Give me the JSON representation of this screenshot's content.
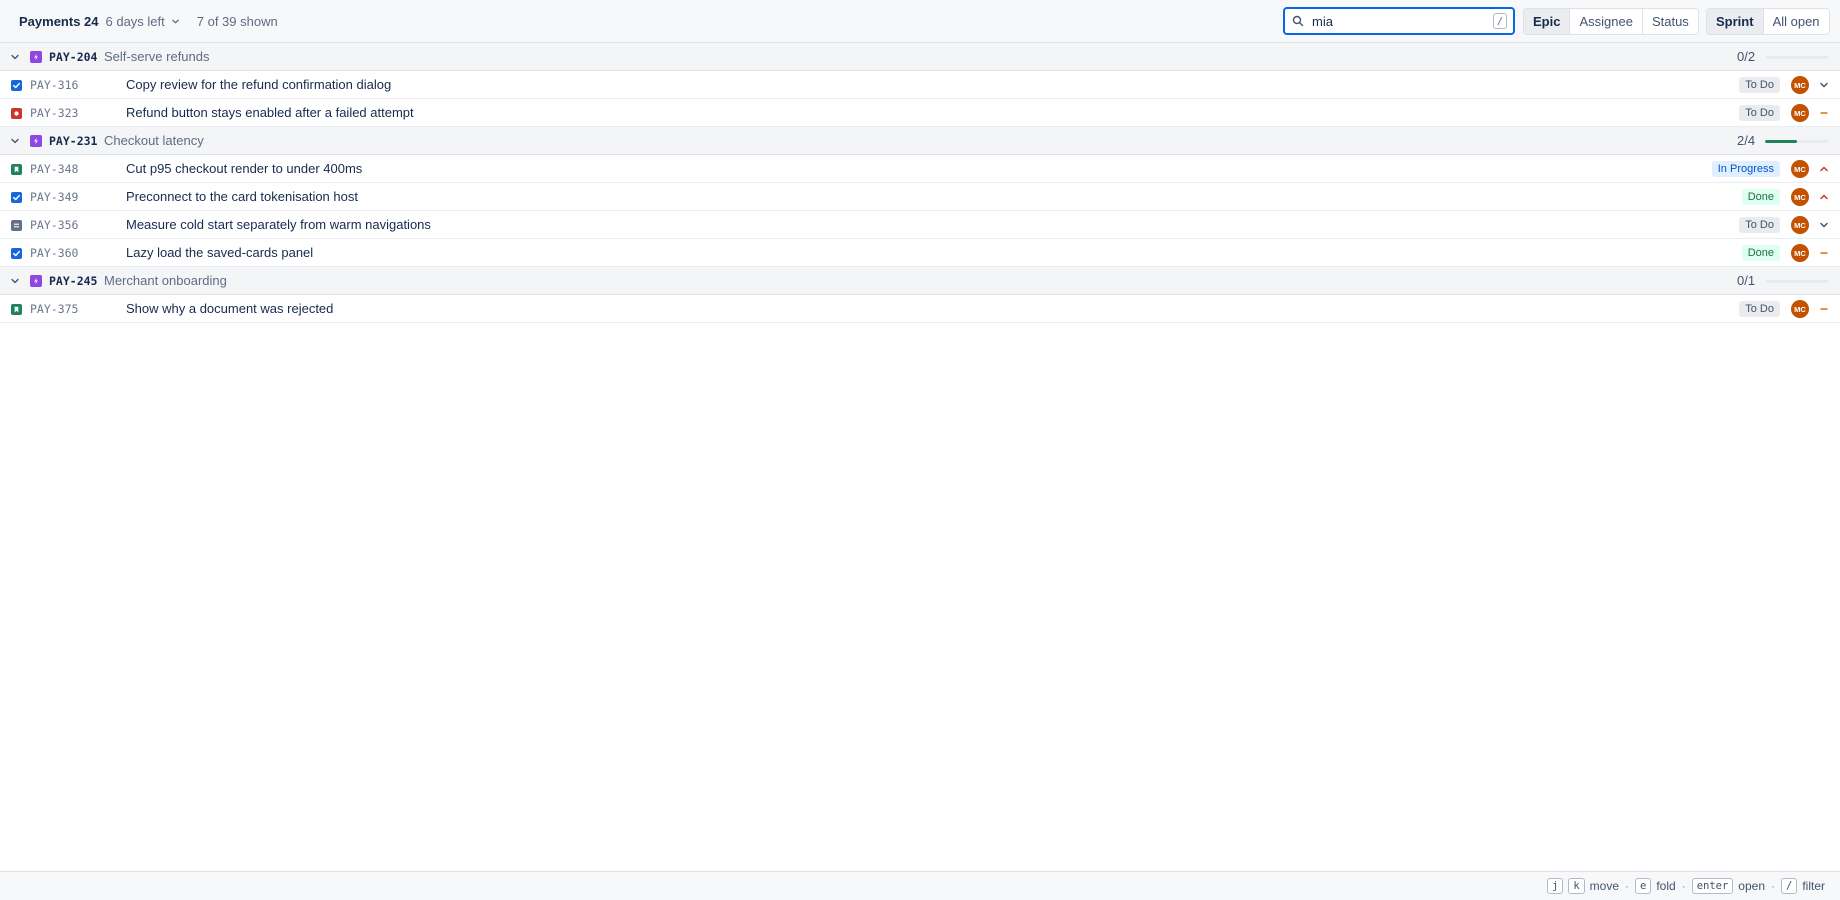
{
  "header": {
    "sprint_name": "Payments 24",
    "days_left": "6 days left",
    "shown_count": "7 of 39 shown",
    "search": {
      "value": "mia",
      "shortcut": "/"
    },
    "group_by": [
      {
        "label": "Epic",
        "active": true
      },
      {
        "label": "Assignee",
        "active": false
      },
      {
        "label": "Status",
        "active": false
      }
    ],
    "scope": [
      {
        "label": "Sprint",
        "active": true
      },
      {
        "label": "All open",
        "active": false
      }
    ]
  },
  "epics": [
    {
      "key": "PAY-204",
      "name": "Self-serve refunds",
      "progress_text": "0/2",
      "progress": 0,
      "issues": [
        {
          "type": "task",
          "key": "PAY-316",
          "summary": "Copy review for the refund confirmation dialog",
          "status": "To Do",
          "status_kind": "todo",
          "assignee": "MC",
          "priority": "low"
        },
        {
          "type": "bug",
          "key": "PAY-323",
          "summary": "Refund button stays enabled after a failed attempt",
          "status": "To Do",
          "status_kind": "todo",
          "assignee": "MC",
          "priority": "medium"
        }
      ]
    },
    {
      "key": "PAY-231",
      "name": "Checkout latency",
      "progress_text": "2/4",
      "progress": 0.5,
      "issues": [
        {
          "type": "story",
          "key": "PAY-348",
          "summary": "Cut p95 checkout render to under 400ms",
          "status": "In Progress",
          "status_kind": "progress",
          "assignee": "MC",
          "priority": "high"
        },
        {
          "type": "task",
          "key": "PAY-349",
          "summary": "Preconnect to the card tokenisation host",
          "status": "Done",
          "status_kind": "done",
          "assignee": "MC",
          "priority": "high"
        },
        {
          "type": "subtask",
          "key": "PAY-356",
          "summary": "Measure cold start separately from warm navigations",
          "status": "To Do",
          "status_kind": "todo",
          "assignee": "MC",
          "priority": "low"
        },
        {
          "type": "task",
          "key": "PAY-360",
          "summary": "Lazy load the saved-cards panel",
          "status": "Done",
          "status_kind": "done",
          "assignee": "MC",
          "priority": "medium"
        }
      ]
    },
    {
      "key": "PAY-245",
      "name": "Merchant onboarding",
      "progress_text": "0/1",
      "progress": 0,
      "issues": [
        {
          "type": "story",
          "key": "PAY-375",
          "summary": "Show why a document was rejected",
          "status": "To Do",
          "status_kind": "todo",
          "assignee": "MC",
          "priority": "medium"
        }
      ]
    }
  ],
  "footer": {
    "hints": [
      {
        "keys": [
          "j",
          "k"
        ],
        "label": "move"
      },
      {
        "keys": [
          "e"
        ],
        "label": "fold"
      },
      {
        "keys": [
          "enter"
        ],
        "label": "open"
      },
      {
        "keys": [
          "/"
        ],
        "label": "filter"
      }
    ]
  },
  "colors": {
    "accent": "#0c66e4",
    "epic": "#8f46e4",
    "task": "#1868db",
    "bug": "#c9372c",
    "story": "#1f845a",
    "subtask": "#626f86",
    "avatar": "#c25100",
    "priority_high": "#c9372c",
    "priority_medium": "#d97008",
    "priority_low": "#44546f"
  },
  "icons": {
    "search": "search-icon",
    "collapse": "chevron-down-icon",
    "epic": "lightning-icon",
    "task": "checkbox-icon",
    "bug": "bug-icon",
    "story": "bookmark-icon",
    "subtask": "subtask-icon"
  }
}
